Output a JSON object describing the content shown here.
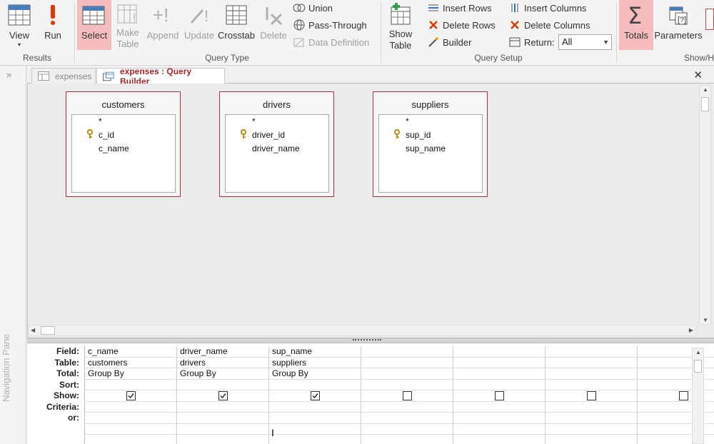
{
  "ribbon": {
    "results": {
      "label": "Results",
      "view": "View",
      "run": "Run"
    },
    "query_type": {
      "label": "Query Type",
      "select": "Select",
      "make_table": "Make\nTable",
      "append": "Append",
      "update": "Update",
      "crosstab": "Crosstab",
      "delete": "Delete",
      "union": "Union",
      "pass_through": "Pass-Through",
      "data_definition": "Data Definition"
    },
    "query_setup": {
      "label": "Query Setup",
      "show_table": "Show\nTable",
      "insert_rows": "Insert Rows",
      "delete_rows": "Delete Rows",
      "builder": "Builder",
      "insert_columns": "Insert Columns",
      "delete_columns": "Delete Columns",
      "return_label": "Return:",
      "return_value": "All"
    },
    "show_hide": {
      "label": "Show/H",
      "totals": "Totals",
      "parameters": "Parameters"
    }
  },
  "nav_pane": {
    "chevron": "»",
    "label": "Navigation Pane"
  },
  "tabs": [
    {
      "label": "expenses",
      "active": false
    },
    {
      "label": "expenses : Query Builder",
      "active": true
    }
  ],
  "close": "✕",
  "tables": [
    {
      "title": "customers",
      "fields": [
        "*",
        "c_id",
        "c_name"
      ],
      "key_field": "c_id"
    },
    {
      "title": "drivers",
      "fields": [
        "*",
        "driver_id",
        "driver_name"
      ],
      "key_field": "driver_id"
    },
    {
      "title": "suppliers",
      "fields": [
        "*",
        "sup_id",
        "sup_name"
      ],
      "key_field": "sup_id"
    }
  ],
  "grid": {
    "row_labels": [
      "Field:",
      "Table:",
      "Total:",
      "Sort:",
      "Show:",
      "Criteria:",
      "or:"
    ],
    "columns": [
      {
        "field": "c_name",
        "table": "customers",
        "total": "Group By",
        "show": true
      },
      {
        "field": "driver_name",
        "table": "drivers",
        "total": "Group By",
        "show": true
      },
      {
        "field": "sup_name",
        "table": "suppliers",
        "total": "Group By",
        "show": true
      },
      {
        "field": "",
        "table": "",
        "total": "",
        "show": false
      },
      {
        "field": "",
        "table": "",
        "total": "",
        "show": false
      },
      {
        "field": "",
        "table": "",
        "total": "",
        "show": false
      },
      {
        "field": "",
        "table": "",
        "total": "",
        "show": false
      }
    ]
  },
  "colors": {
    "accent": "#a4262c",
    "active_button": "#f4bcbc"
  }
}
